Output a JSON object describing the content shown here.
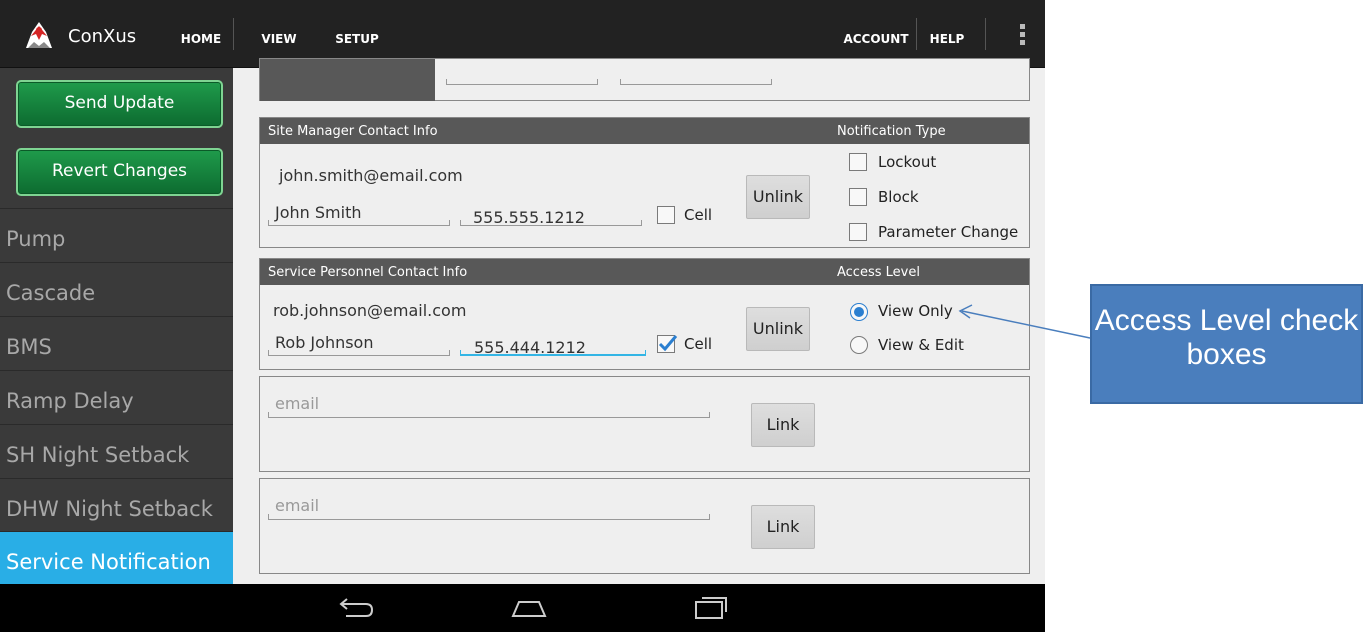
{
  "app": {
    "title": "ConXus"
  },
  "nav": {
    "home": "HOME",
    "view": "VIEW",
    "setup": "SETUP",
    "account": "ACCOUNT",
    "help": "HELP"
  },
  "sidebar": {
    "send_update": "Send Update",
    "revert_changes": "Revert Changes",
    "items": [
      {
        "label": "Pump"
      },
      {
        "label": "Cascade"
      },
      {
        "label": "BMS"
      },
      {
        "label": "Ramp Delay"
      },
      {
        "label": "SH Night Setback"
      },
      {
        "label": "DHW Night Setback"
      },
      {
        "label": "Service Notification",
        "active": true
      }
    ]
  },
  "site_manager": {
    "header": "Site Manager Contact Info",
    "notification_header": "Notification Type",
    "email": "john.smith@email.com",
    "name": "John Smith",
    "phone": "555.555.1212",
    "cell_label": "Cell",
    "cell_checked": false,
    "unlink_label": "Unlink",
    "notification_types": [
      {
        "label": "Lockout",
        "checked": false
      },
      {
        "label": "Block",
        "checked": false
      },
      {
        "label": "Parameter Change",
        "checked": false
      }
    ]
  },
  "service_personnel": {
    "header": "Service Personnel Contact Info",
    "access_header": "Access Level",
    "email": "rob.johnson@email.com",
    "name": "Rob Johnson",
    "phone": "555.444.1212",
    "cell_label": "Cell",
    "cell_checked": true,
    "unlink_label": "Unlink",
    "access_levels": [
      {
        "label": "View Only",
        "selected": true
      },
      {
        "label": "View & Edit",
        "selected": false
      }
    ]
  },
  "empty_contacts": [
    {
      "email_placeholder": "email",
      "link_label": "Link"
    },
    {
      "email_placeholder": "email",
      "link_label": "Link"
    }
  ],
  "callout": {
    "text": "Access Level check boxes"
  },
  "colors": {
    "accent": "#33b5e5",
    "active_item": "#29aee6",
    "green_button": "#1f9b4b",
    "callout": "#4a7ebd"
  }
}
